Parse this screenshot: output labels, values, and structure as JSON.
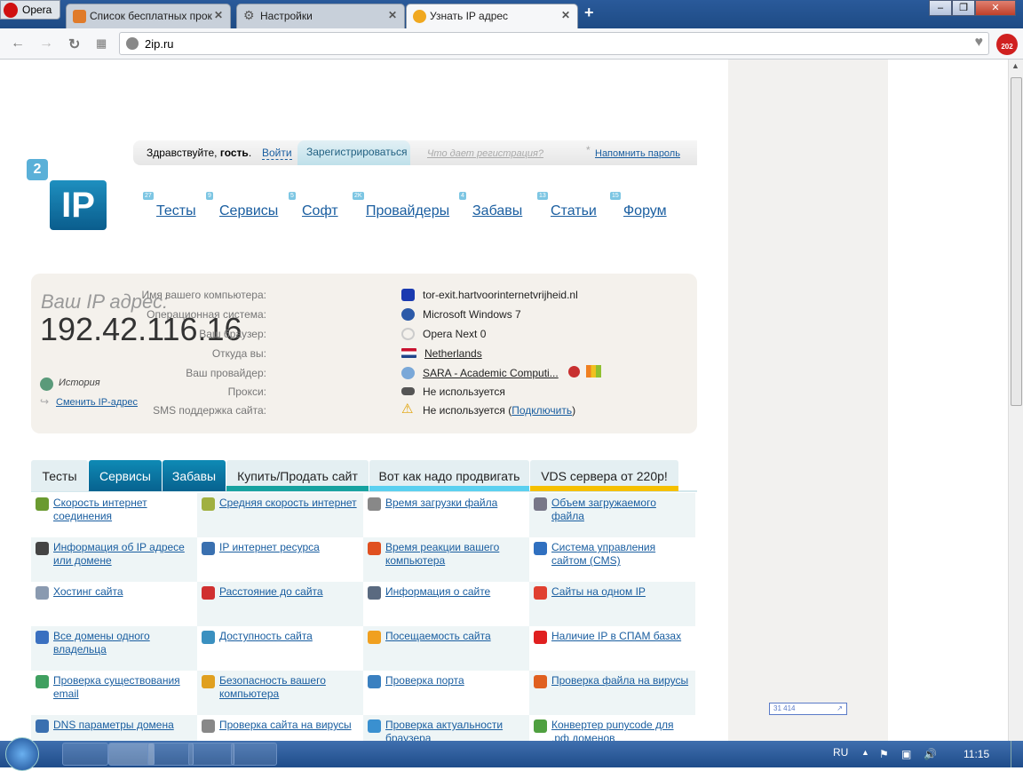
{
  "browser": {
    "menu_label": "Opera",
    "tabs": [
      {
        "title": "Список бесплатных прок",
        "icon": "fox-icon"
      },
      {
        "title": "Настройки",
        "icon": "gear-icon"
      },
      {
        "title": "Узнать IP адрес",
        "icon": "2ip-favicon",
        "active": true
      }
    ],
    "new_tab": "+",
    "url": "2ip.ru",
    "badge_count": "202"
  },
  "userbar": {
    "greeting": "Здравствуйте, ",
    "guest": "гость",
    "dot": ".",
    "login": "Войти",
    "register": "Зарегистрироваться",
    "why": "Что дает регистрация?",
    "remind": "Напомнить пароль"
  },
  "logo": {
    "top": "2",
    "main": "IP"
  },
  "nav": [
    {
      "label": "Тесты",
      "badge": "27"
    },
    {
      "label": "Сервисы",
      "badge": "9"
    },
    {
      "label": "Софт",
      "badge": "5"
    },
    {
      "label": "Провайдеры",
      "badge": "2K"
    },
    {
      "label": "Забавы",
      "badge": "4"
    },
    {
      "label": "Статьи",
      "badge": "13"
    },
    {
      "label": "Форум",
      "badge": "15"
    }
  ],
  "ip": {
    "heading": "Ваш IP адрес:",
    "address": "192.42.116.16",
    "history": "История",
    "change": "Сменить IP-адрес",
    "rows": [
      {
        "label": "Имя вашего компьютера:",
        "value": "tor-exit.hartvoorinternetvrijheid.nl",
        "icon": "computer-icon"
      },
      {
        "label": "Операционная система:",
        "value": "Microsoft Windows 7",
        "icon": "windows-icon"
      },
      {
        "label": "Ваш браузер:",
        "value": "Opera Next 0",
        "icon": "opera-icon"
      },
      {
        "label": "Откуда вы:",
        "value": "Netherlands",
        "icon": "netherlands-flag-icon",
        "link": true
      },
      {
        "label": "Ваш провайдер:",
        "value": "SARA - Academic Computi...",
        "icon": "help-icon",
        "link": true
      },
      {
        "label": "Прокси:",
        "value": "Не используется",
        "icon": "glasses-icon"
      },
      {
        "label": "SMS поддержка сайта:",
        "value": "Не используется (",
        "link_text": "Подключить",
        "suffix": ")",
        "icon": "warning-icon"
      }
    ]
  },
  "tabs2": [
    "Тесты",
    "Сервисы",
    "Забавы",
    "Купить/Продать сайт",
    "Вот как надо продвигать",
    "VDS сервера от 220р!"
  ],
  "services": [
    [
      "Скорость интернет соединения",
      "Средняя скорость интернет",
      "Время загрузки файла",
      "Объем загружаемого файла"
    ],
    [
      "Информация об IP адресе или домене",
      "IP интернет ресурса",
      "Время реакции вашего компьютера",
      "Система управления сайтом (CMS)"
    ],
    [
      "Хостинг сайта",
      "Расстояние до сайта",
      "Информация о сайте",
      "Сайты на одном IP"
    ],
    [
      "Все домены одного владельца",
      "Доступность сайта",
      "Посещаемость сайта",
      "Наличие IP в СПАМ базах"
    ],
    [
      "Проверка существования email",
      "Безопасность вашего компьютера",
      "Проверка порта",
      "Проверка файла на вирусы"
    ],
    [
      "DNS параметры домена",
      "Проверка сайта на вирусы",
      "Проверка актуальности браузера",
      "Конвертер punycode для .рф доменов"
    ]
  ],
  "counter": "31 414",
  "taskbar": {
    "lang": "RU",
    "time": "11:15"
  }
}
